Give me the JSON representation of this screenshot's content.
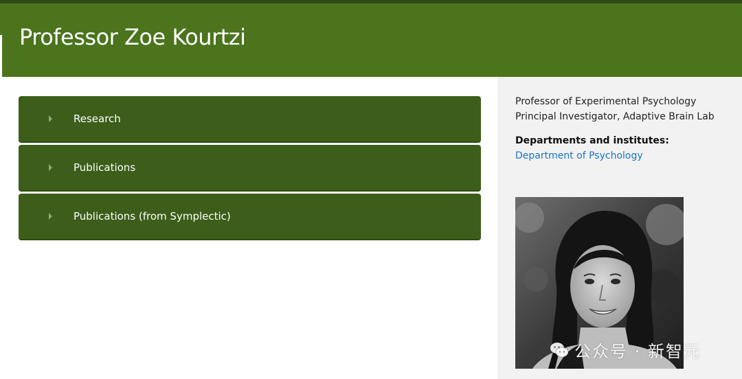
{
  "header": {
    "title": "Professor Zoe Kourtzi"
  },
  "accordion": {
    "items": [
      {
        "label": "Research"
      },
      {
        "label": "Publications"
      },
      {
        "label": "Publications (from Symplectic)"
      }
    ]
  },
  "sidebar": {
    "roles": [
      "Professor of Experimental Psychology",
      "Principal Investigator, Adaptive Brain Lab"
    ],
    "departments_heading": "Departments and institutes:",
    "department_link": "Department of Psychology"
  },
  "watermark": {
    "text": "公众号 · 新智元"
  },
  "colors": {
    "header": "#4b741d",
    "accordion": "#3c5e1a",
    "link": "#1a73c9",
    "sidebar_bg": "#f2f2f2"
  }
}
